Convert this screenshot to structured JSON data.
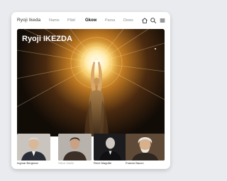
{
  "brand": {
    "name": "Ryoji Ikeda"
  },
  "nav": {
    "items": [
      {
        "label": "Name"
      },
      {
        "label": "Plätt"
      },
      {
        "label": "Gkow"
      },
      {
        "label": "Parsa"
      },
      {
        "label": "Dews"
      }
    ],
    "active_index": 2
  },
  "icons": {
    "home": "home-icon",
    "search": "search-icon",
    "menu": "menu-icon"
  },
  "hero": {
    "title": "Ryoji IKEZDA"
  },
  "thumbnails": [
    {
      "caption": "Ingmar Bergman"
    },
    {
      "caption": "Steve Marlin"
    },
    {
      "caption": "René Magritte"
    },
    {
      "caption": "Francis Bacon"
    }
  ],
  "colors": {
    "background": "#e9ebee",
    "card": "#ffffff",
    "hero_glow": "#ffcf5a"
  }
}
